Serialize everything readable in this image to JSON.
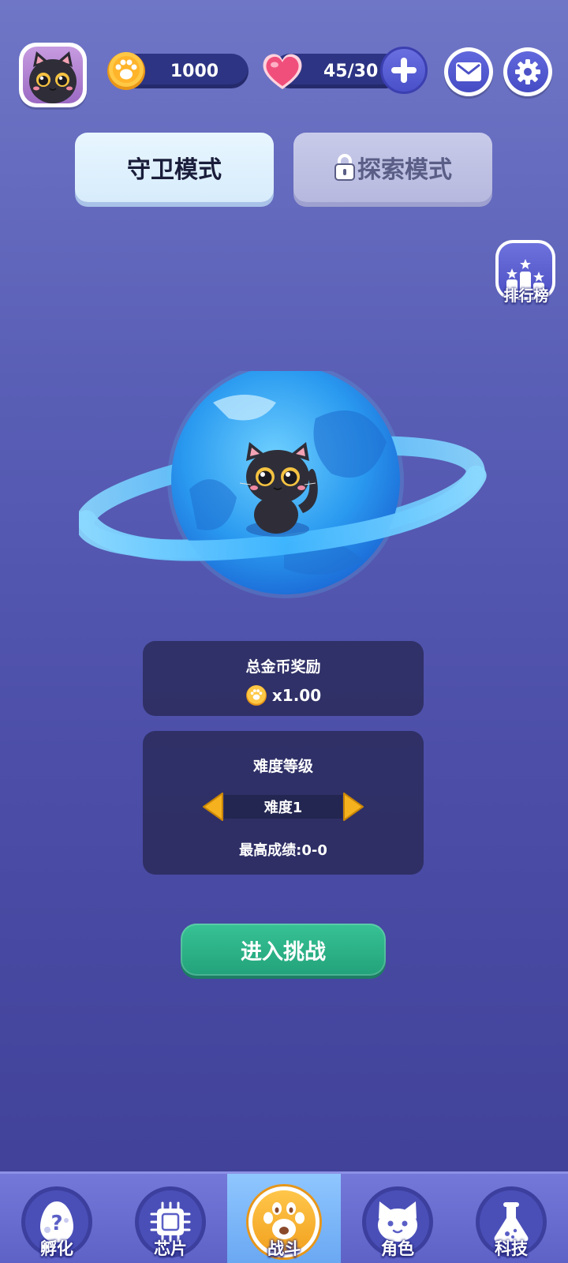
{
  "header": {
    "avatar_icon": "black-cat-icon",
    "coins": "1000",
    "hearts": "45/30"
  },
  "modes": {
    "guard_label": "守卫模式",
    "explore_label": "探索模式"
  },
  "leaderboard": {
    "label": "排行榜"
  },
  "reward_panel": {
    "title": "总金币奖励",
    "multiplier": "x1.00"
  },
  "difficulty_panel": {
    "title": "难度等级",
    "current": "难度1",
    "best_score": "最高成绩:0-0"
  },
  "challenge_button": {
    "label": "进入挑战"
  },
  "bottom_nav": {
    "items": [
      {
        "label": "孵化",
        "icon": "egg-icon"
      },
      {
        "label": "芯片",
        "icon": "chip-icon"
      },
      {
        "label": "战斗",
        "icon": "paw-icon",
        "active": true
      },
      {
        "label": "角色",
        "icon": "cat-face-icon"
      },
      {
        "label": "科技",
        "icon": "flask-icon"
      }
    ]
  },
  "colors": {
    "accent_green": "#2bb488",
    "coin_gold": "#f2a11f",
    "heart_pink": "#f04f7c",
    "nav_active": "#7ab4f8"
  }
}
